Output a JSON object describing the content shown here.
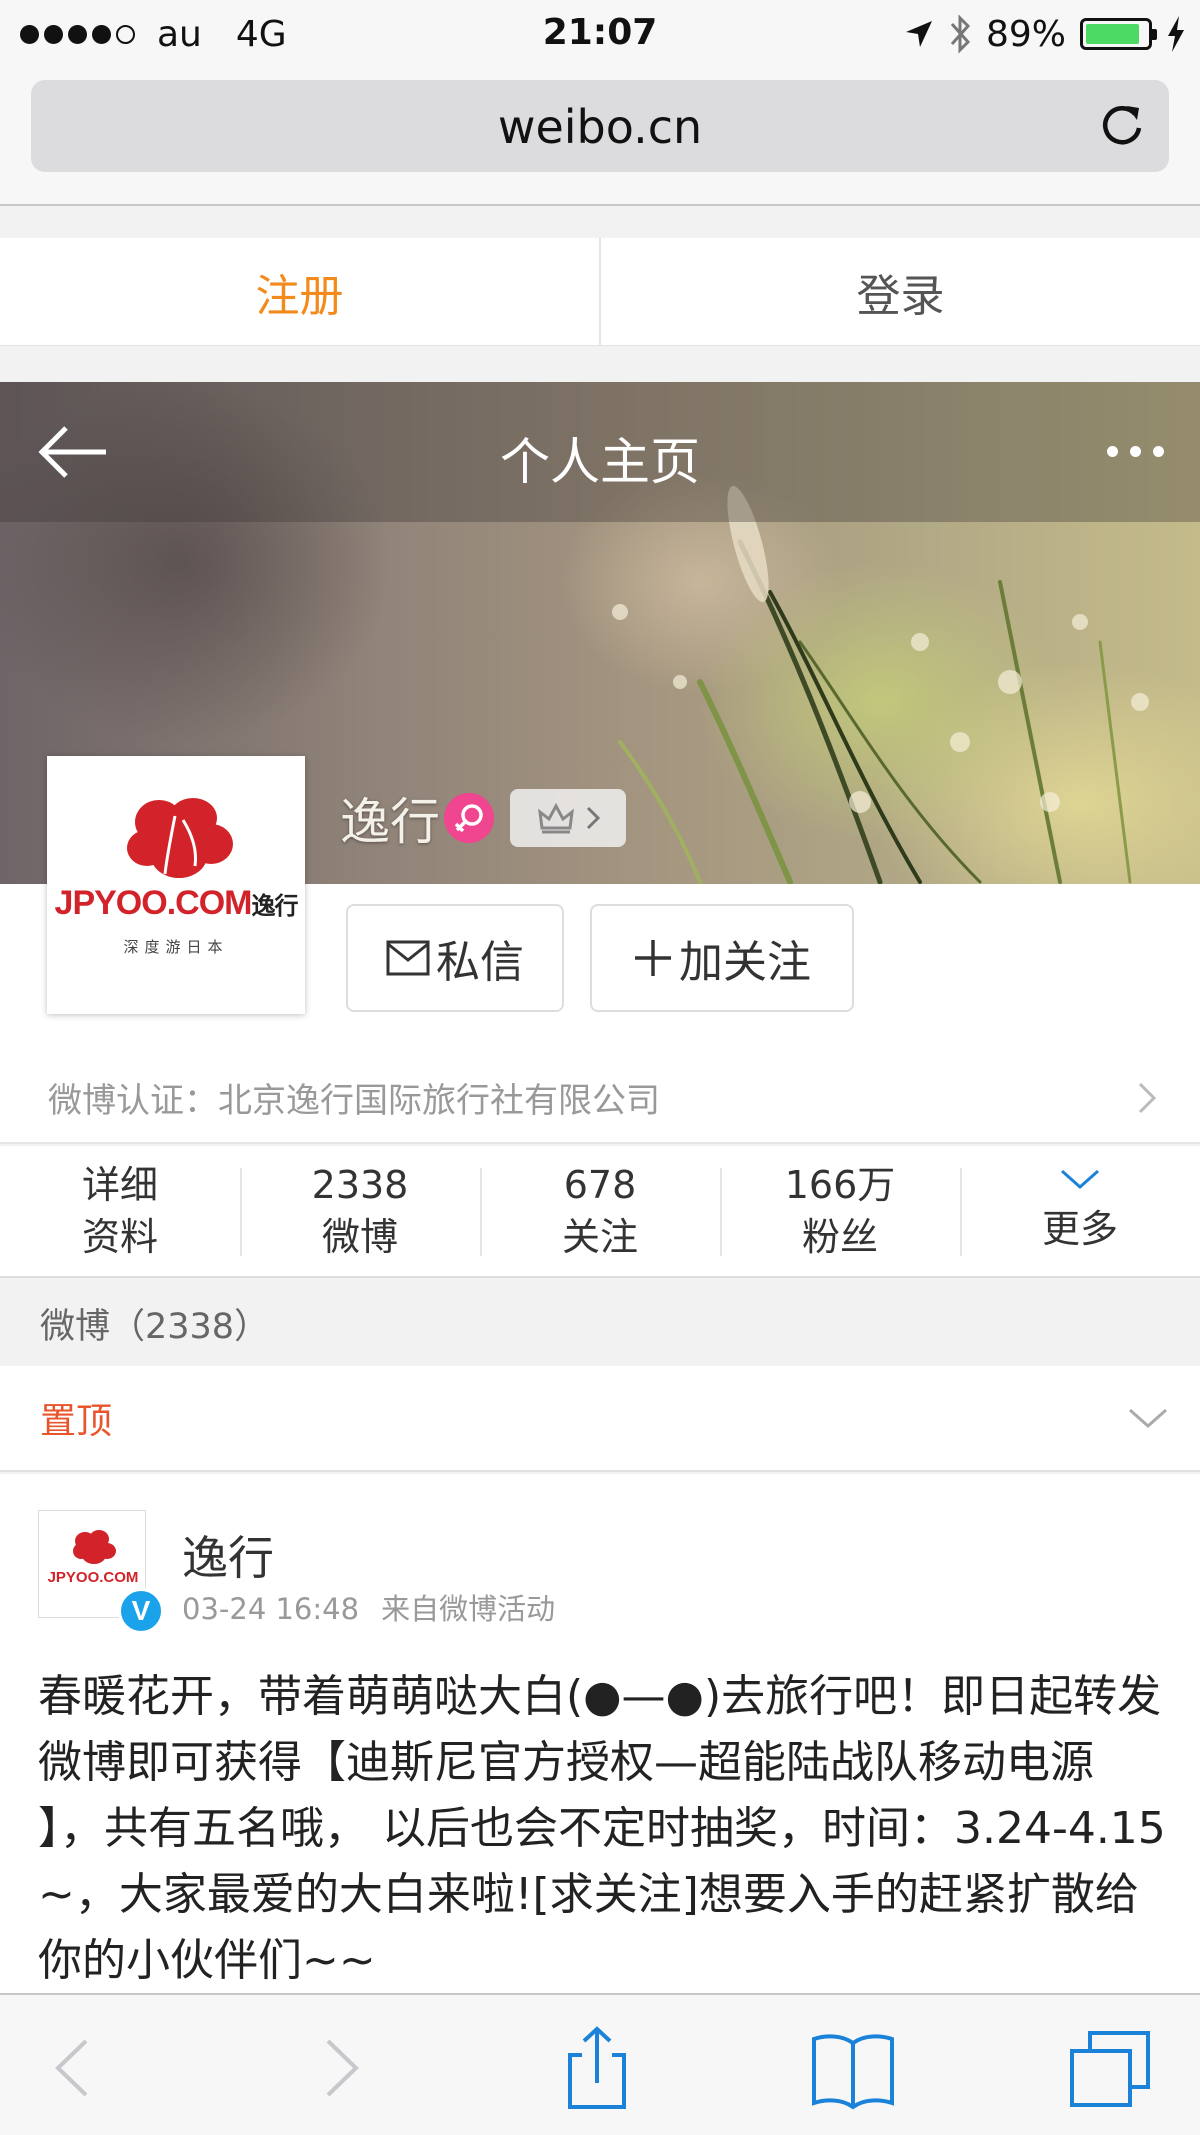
{
  "status_bar": {
    "carrier": "au",
    "network": "4G",
    "time": "21:07",
    "battery_percent_text": "89%",
    "battery_level": 0.89
  },
  "browser": {
    "url": "weibo.cn"
  },
  "auth": {
    "register_label": "注册",
    "login_label": "登录"
  },
  "header": {
    "title": "个人主页"
  },
  "profile": {
    "name": "逸行",
    "avatar_brand": "JPYOO.COM",
    "avatar_brand_cn": "逸行",
    "avatar_tagline": "深度游日本",
    "message_button": "私信",
    "follow_button": "加关注",
    "verification": "微博认证：北京逸行国际旅行社有限公司"
  },
  "stats": [
    {
      "top": "详细",
      "bottom": "资料"
    },
    {
      "top": "2338",
      "bottom": "微博"
    },
    {
      "top": "678",
      "bottom": "关注"
    },
    {
      "top": "166万",
      "bottom": "粉丝"
    },
    {
      "top": "",
      "bottom": "更多"
    }
  ],
  "feed": {
    "section_title": "微博（2338）",
    "pinned_label": "置顶"
  },
  "post": {
    "author": "逸行",
    "time": "03-24 16:48",
    "source": "来自微博活动",
    "verified_badge": "V",
    "text": "春暖花开，带着萌萌哒大白(●—●)去旅行吧！即日起转发微博即可获得【迪斯尼官方授权—超能陆战队移动电源 】，共有五名哦， 以后也会不定时抽奖，时间：3.24-4.15~，大家最爱的大白来啦![求关注]想要入手的赶紧扩散给你的小伙伴们~~"
  },
  "colors": {
    "register": "#f28a1c",
    "pinned": "#e8542b",
    "ios_blue": "#1a82d8",
    "battery": "#4cd964",
    "gender": "#f0458f",
    "verified": "#1aa3ea"
  },
  "icons": [
    "signal-dots-icon",
    "location-arrow-icon",
    "bluetooth-icon",
    "battery-icon",
    "charging-bolt-icon",
    "reload-icon",
    "back-arrow-icon",
    "more-dots-icon",
    "female-icon",
    "crown-icon",
    "mail-icon",
    "plus-icon",
    "chevron-right-icon",
    "chevron-down-icon",
    "verified-icon",
    "back-icon",
    "forward-icon",
    "share-icon",
    "bookmarks-icon",
    "tabs-icon"
  ]
}
